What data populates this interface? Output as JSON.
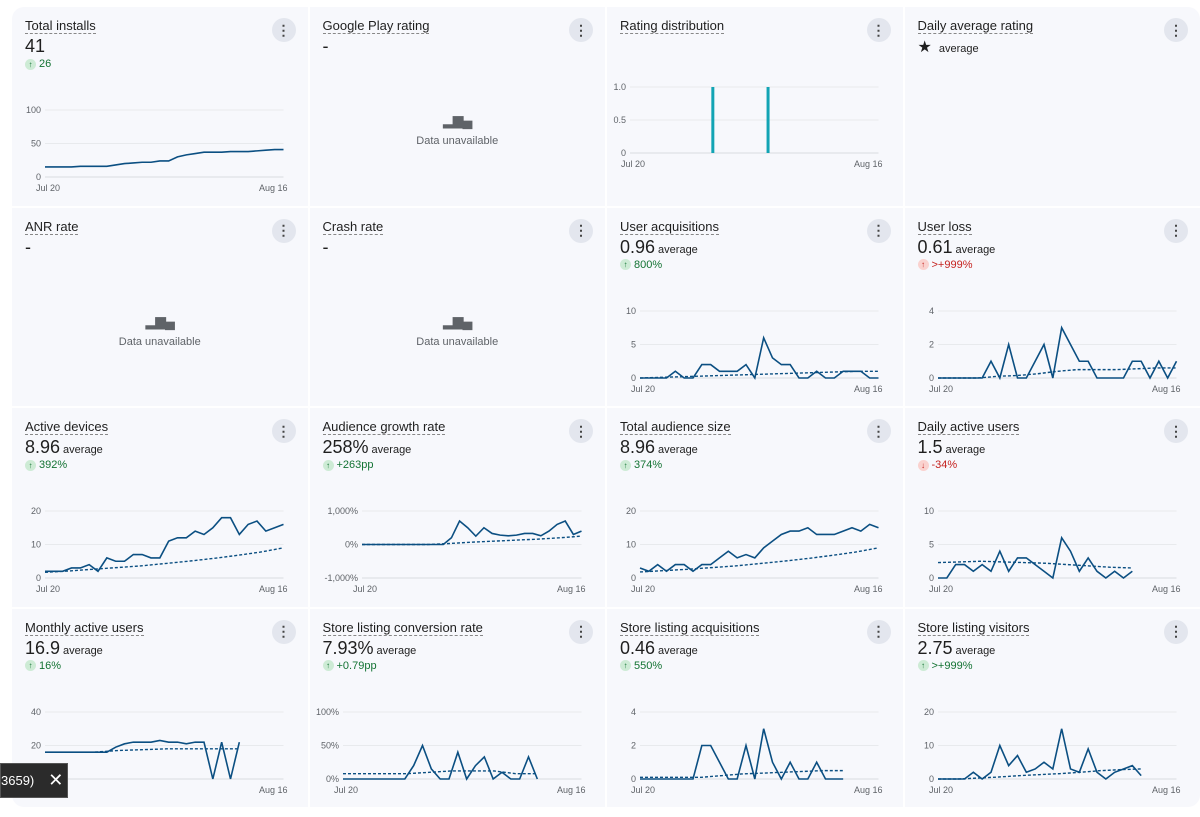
{
  "colors": {
    "line": "#0b4f82",
    "bar": "#12a4b4",
    "good": "#137333",
    "bad": "#c5221f"
  },
  "x_labels": [
    "Jul 20",
    "Aug 16"
  ],
  "cards": [
    {
      "title": "Total installs",
      "value": "41",
      "suffix": "",
      "delta": {
        "text": "26",
        "dir": "up",
        "tone": "good"
      },
      "chart": {
        "type": "line",
        "yticks": [
          "0",
          "50",
          "100"
        ],
        "ymin": 0,
        "ymax": 100,
        "values": [
          15,
          15,
          15,
          15,
          16,
          16,
          16,
          16,
          18,
          20,
          21,
          22,
          22,
          24,
          24,
          30,
          33,
          35,
          37,
          37,
          37,
          38,
          38,
          38,
          39,
          40,
          41,
          41
        ]
      }
    },
    {
      "title": "Google Play rating",
      "value": "-",
      "unavailable": "Data unavailable"
    },
    {
      "title": "Rating distribution",
      "value": "",
      "chart": {
        "type": "bar",
        "yticks": [
          "0",
          "0.5",
          "1.0"
        ],
        "ymin": 0,
        "ymax": 1,
        "bars": [
          {
            "day": 9,
            "value": 1
          },
          {
            "day": 15,
            "value": 1
          }
        ]
      }
    },
    {
      "title": "Daily average rating",
      "value": "",
      "suffix": "average",
      "icon": "star-icon"
    },
    {
      "title": "ANR rate",
      "value": "-",
      "unavailable": "Data unavailable"
    },
    {
      "title": "Crash rate",
      "value": "-",
      "unavailable": "Data unavailable"
    },
    {
      "title": "User acquisitions",
      "value": "0.96",
      "suffix": "average",
      "delta": {
        "text": "800%",
        "dir": "up",
        "tone": "good"
      },
      "chart": {
        "type": "line",
        "yticks": [
          "0",
          "5",
          "10"
        ],
        "ymin": 0,
        "ymax": 10,
        "values": [
          0,
          0,
          0,
          0,
          1,
          0,
          0,
          2,
          2,
          1,
          1,
          1,
          2,
          0,
          6,
          3,
          2,
          2,
          0,
          0,
          1,
          0,
          0,
          1,
          1,
          1,
          0,
          0
        ],
        "avg": [
          0,
          0.1,
          0.2,
          0.3,
          0.4,
          0.5,
          0.6,
          0.7,
          0.8,
          0.9,
          1,
          1
        ]
      }
    },
    {
      "title": "User loss",
      "value": "0.61",
      "suffix": "average",
      "delta": {
        "text": ">+999%",
        "dir": "up",
        "tone": "bad"
      },
      "chart": {
        "type": "line",
        "yticks": [
          "0",
          "2",
          "4"
        ],
        "ymin": 0,
        "ymax": 4,
        "values": [
          0,
          0,
          0,
          0,
          0,
          0,
          1,
          0,
          2,
          0,
          0,
          1,
          2,
          0,
          3,
          2,
          1,
          1,
          0,
          0,
          0,
          0,
          1,
          1,
          0,
          1,
          0,
          1
        ],
        "avg": [
          0,
          0,
          0,
          0.1,
          0.15,
          0.25,
          0.4,
          0.5,
          0.5,
          0.5,
          0.55,
          0.6,
          0.6
        ]
      }
    },
    {
      "title": "Active devices",
      "value": "8.96",
      "suffix": "average",
      "delta": {
        "text": "392%",
        "dir": "up",
        "tone": "good"
      },
      "chart": {
        "type": "line",
        "yticks": [
          "0",
          "10",
          "20"
        ],
        "ymin": 0,
        "ymax": 20,
        "values": [
          2,
          2,
          2,
          3,
          3,
          4,
          2,
          6,
          5,
          5,
          7,
          7,
          6,
          6,
          11,
          12,
          12,
          14,
          13,
          15,
          18,
          18,
          13,
          16,
          17,
          14,
          15,
          16
        ],
        "avg": [
          1.7,
          2.1,
          2.6,
          3.1,
          3.6,
          4.3,
          5,
          5.8,
          6.7,
          7.7,
          9
        ]
      }
    },
    {
      "title": "Audience growth rate",
      "value": "258%",
      "suffix": "average",
      "delta": {
        "text": "+263pp",
        "dir": "up",
        "tone": "good"
      },
      "chart": {
        "type": "line",
        "yticks": [
          "-1,000%",
          "0%",
          "1,000%"
        ],
        "ymin": -1000,
        "ymax": 1000,
        "values": [
          0,
          0,
          0,
          0,
          0,
          0,
          0,
          0,
          0,
          0,
          0,
          200,
          700,
          500,
          250,
          500,
          330,
          280,
          260,
          280,
          330,
          330,
          260,
          400,
          600,
          700,
          300,
          400
        ],
        "avg": [
          0,
          0,
          0,
          0,
          30,
          70,
          100,
          130,
          160,
          200,
          250
        ]
      }
    },
    {
      "title": "Total audience size",
      "value": "8.96",
      "suffix": "average",
      "delta": {
        "text": "374%",
        "dir": "up",
        "tone": "good"
      },
      "chart": {
        "type": "line",
        "yticks": [
          "0",
          "10",
          "20"
        ],
        "ymin": 0,
        "ymax": 20,
        "values": [
          3,
          2,
          4,
          2,
          4,
          4,
          2,
          4,
          4,
          6,
          8,
          6,
          7,
          6,
          9,
          11,
          13,
          14,
          14,
          15,
          13,
          13,
          13,
          14,
          15,
          14,
          16,
          15
        ],
        "avg": [
          1.8,
          2.2,
          2.6,
          3.1,
          3.6,
          4.3,
          5,
          5.8,
          6.7,
          7.7,
          9
        ]
      }
    },
    {
      "title": "Daily active users",
      "value": "1.5",
      "suffix": "average",
      "delta": {
        "text": "-34%",
        "dir": "down",
        "tone": "bad"
      },
      "chart": {
        "type": "line",
        "yticks": [
          "0",
          "5",
          "10"
        ],
        "ymin": 0,
        "ymax": 10,
        "values": [
          0,
          0,
          2,
          2,
          1,
          2,
          1,
          4,
          1,
          3,
          3,
          2,
          1,
          0,
          6,
          4,
          1,
          3,
          1,
          0,
          1,
          0,
          1
        ],
        "avg": [
          2.3,
          2.4,
          2.5,
          2.4,
          2.3,
          2.2,
          2,
          1.8,
          1.6,
          1.5
        ]
      }
    },
    {
      "title": "Monthly active users",
      "value": "16.9",
      "suffix": "average",
      "delta": {
        "text": "16%",
        "dir": "up",
        "tone": "good"
      },
      "chart": {
        "type": "line",
        "yticks": [
          "0",
          "20",
          "40"
        ],
        "ymin": 0,
        "ymax": 40,
        "values": [
          16,
          16,
          16,
          16,
          16,
          16,
          16,
          16,
          19,
          21,
          22,
          22,
          22,
          23,
          22,
          22,
          21,
          22,
          22,
          0,
          22,
          0,
          22
        ],
        "avg": [
          16,
          16,
          16,
          17,
          17.5,
          18,
          18,
          18,
          18
        ]
      }
    },
    {
      "title": "Store listing conversion rate",
      "value": "7.93%",
      "suffix": "average",
      "delta": {
        "text": "+0.79pp",
        "dir": "up",
        "tone": "good"
      },
      "chart": {
        "type": "line",
        "yticks": [
          "0%",
          "50%",
          "100%"
        ],
        "ymin": 0,
        "ymax": 100,
        "values": [
          0,
          0,
          0,
          0,
          0,
          0,
          0,
          0,
          20,
          50,
          15,
          0,
          0,
          40,
          0,
          20,
          33,
          0,
          10,
          0,
          0,
          33,
          0
        ],
        "avg": [
          8,
          8,
          8,
          8,
          10,
          12,
          12,
          12,
          8,
          8
        ]
      }
    },
    {
      "title": "Store listing acquisitions",
      "value": "0.46",
      "suffix": "average",
      "delta": {
        "text": "550%",
        "dir": "up",
        "tone": "good"
      },
      "chart": {
        "type": "line",
        "yticks": [
          "0",
          "2",
          "4"
        ],
        "ymin": 0,
        "ymax": 4,
        "values": [
          0,
          0,
          0,
          0,
          0,
          0,
          0,
          2,
          2,
          1,
          0,
          0,
          2,
          0,
          3,
          1,
          0,
          1,
          0,
          0,
          1,
          0,
          0,
          0
        ],
        "avg": [
          0.1,
          0.1,
          0.1,
          0.1,
          0.2,
          0.3,
          0.35,
          0.4,
          0.45,
          0.5,
          0.5
        ]
      }
    },
    {
      "title": "Store listing visitors",
      "value": "2.75",
      "suffix": "average",
      "delta": {
        "text": ">+999%",
        "dir": "up",
        "tone": "good"
      },
      "chart": {
        "type": "line",
        "yticks": [
          "0",
          "10",
          "20"
        ],
        "ymin": 0,
        "ymax": 20,
        "values": [
          0,
          0,
          0,
          0,
          2,
          0,
          2,
          10,
          4,
          7,
          2,
          3,
          5,
          3,
          15,
          3,
          2,
          9,
          2,
          0,
          2,
          3,
          4,
          1
        ],
        "avg": [
          0,
          0,
          0.3,
          0.6,
          1,
          1.3,
          1.6,
          2,
          2.5,
          2.8,
          3
        ]
      }
    }
  ],
  "snackbar": {
    "text": "3659)",
    "close": "✕"
  }
}
